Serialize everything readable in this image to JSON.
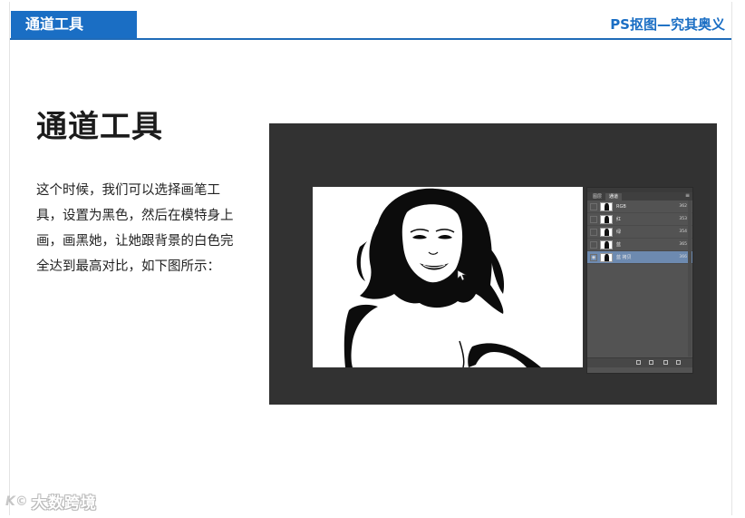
{
  "header": {
    "tab_label": "通道工具",
    "right_title": "PS抠图—究其奥义"
  },
  "main": {
    "title": "通道工具",
    "body": "这个时候，我们可以选择画笔工具，设置为黑色，然后在模特身上画，画黑她，让她跟背景的白色完全达到最高对比，如下图所示："
  },
  "screenshot": {
    "panel_tabs": [
      "图层",
      "通道"
    ],
    "channels": [
      {
        "name": "RGB",
        "shortcut": "362"
      },
      {
        "name": "红",
        "shortcut": "353"
      },
      {
        "name": "绿",
        "shortcut": "354"
      },
      {
        "name": "蓝",
        "shortcut": "365"
      },
      {
        "name": "蓝 拷贝",
        "shortcut": "366"
      }
    ]
  },
  "watermark": {
    "logo": "K©",
    "text": "大数跨境"
  },
  "colors": {
    "brand_blue": "#1a6ec4",
    "ps_dark": "#323232",
    "panel_gray": "#535353",
    "selected_row": "#6d8ab0"
  }
}
